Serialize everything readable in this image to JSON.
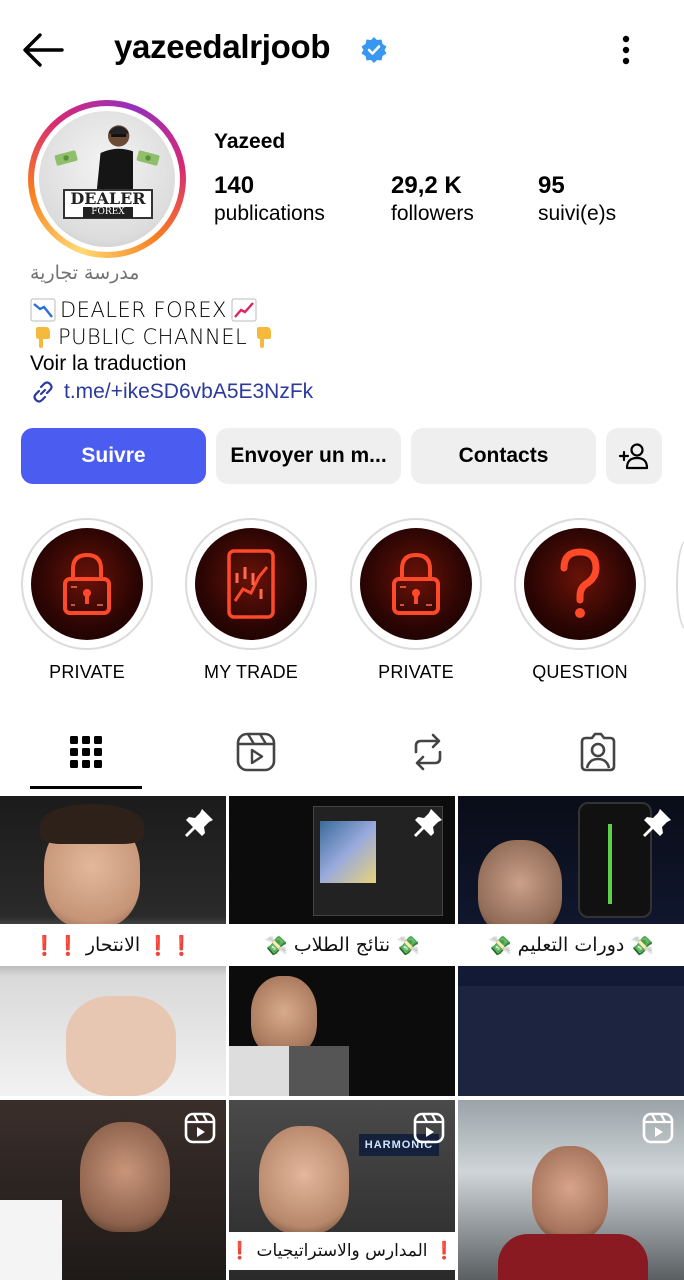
{
  "header": {
    "username": "yazeedalrjoob",
    "verified": true
  },
  "profile": {
    "display_name": "Yazeed",
    "avatar_logo_line1": "DEALER",
    "avatar_logo_line2": "FOREX",
    "stats": [
      {
        "value": "140",
        "label": "publications"
      },
      {
        "value": "29,2 K",
        "label": "followers"
      },
      {
        "value": "95",
        "label": "suivi(e)s"
      }
    ],
    "category": "مدرسة تجارية",
    "bio_line1": "DEALER FOREX",
    "bio_line2": "PUBLIC CHANNEL",
    "translate": "Voir la traduction",
    "link": "t.me/+ikeSD6vbA5E3NzFk"
  },
  "actions": {
    "follow": "Suivre",
    "message": "Envoyer un m...",
    "contacts": "Contacts"
  },
  "highlights": [
    {
      "label": "PRIVATE",
      "icon": "padlock-icon"
    },
    {
      "label": "MY TRADE",
      "icon": "tablet-chart-icon"
    },
    {
      "label": "PRIVATE",
      "icon": "padlock-icon"
    },
    {
      "label": "QUESTION",
      "icon": "question-mark-icon"
    }
  ],
  "tabs": [
    {
      "name": "grid",
      "icon": "grid-icon",
      "active": true
    },
    {
      "name": "reels",
      "icon": "reels-icon",
      "active": false
    },
    {
      "name": "reposts",
      "icon": "repost-icon",
      "active": false
    },
    {
      "name": "tagged",
      "icon": "tagged-icon",
      "active": false
    }
  ],
  "posts": [
    {
      "caption": "الانتحار",
      "badge": "pin-icon"
    },
    {
      "caption": "نتائج الطلاب",
      "badge": "pin-icon"
    },
    {
      "caption": "دورات التعليم",
      "badge": "pin-icon"
    },
    {
      "caption": "",
      "badge": "reel-icon"
    },
    {
      "caption": "المدارس والاستراتيجيات",
      "badge": "reel-icon",
      "overlay_text": "HARMONIC"
    },
    {
      "caption": "",
      "badge": "reel-icon"
    }
  ],
  "colors": {
    "primary_button": "#4b5cf0",
    "secondary_button": "#efefef",
    "link": "#2b3a9c",
    "verified": "#3897f0",
    "highlight_glow": "#ff3b1f"
  }
}
